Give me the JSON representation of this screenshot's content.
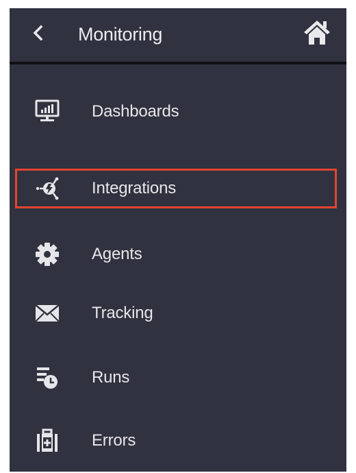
{
  "header": {
    "title": "Monitoring",
    "back_icon": "chevron-left-icon",
    "home_icon": "home-icon"
  },
  "menu": {
    "items": [
      {
        "label": "Dashboards",
        "icon": "monitor-chart-icon",
        "selected": false
      },
      {
        "label": "Integrations",
        "icon": "integration-plug-icon",
        "selected": true
      },
      {
        "label": "Agents",
        "icon": "gear-icon",
        "selected": false
      },
      {
        "label": "Tracking",
        "icon": "envelope-icon",
        "selected": false
      },
      {
        "label": "Runs",
        "icon": "list-clock-icon",
        "selected": false
      },
      {
        "label": "Errors",
        "icon": "first-aid-kit-icon",
        "selected": false
      }
    ]
  },
  "colors": {
    "panel_background": "#31323f",
    "header_divider": "#101014",
    "text": "#e6e6ea",
    "selection_border": "#e2452f"
  }
}
